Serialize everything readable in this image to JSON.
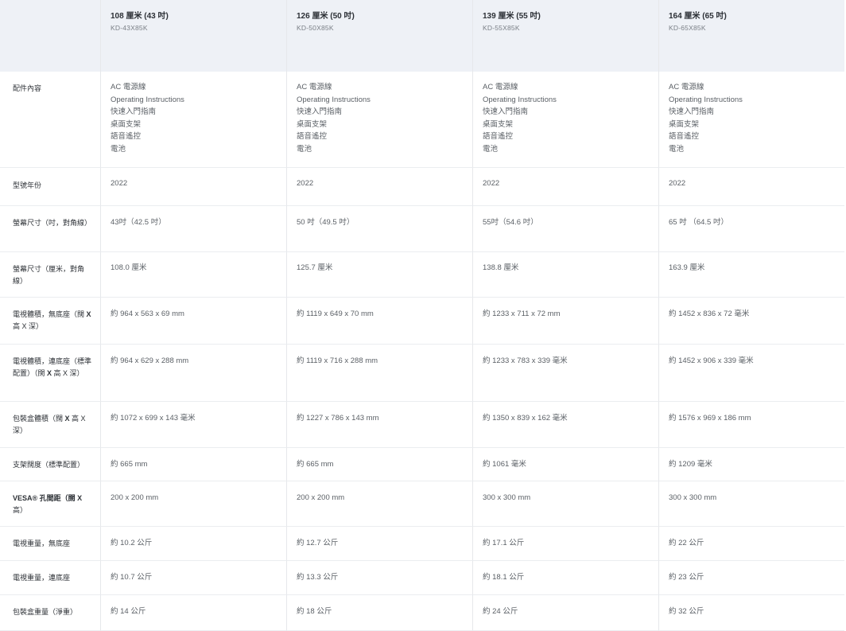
{
  "columns": [
    {
      "size": "108 厘米 (43 吋)",
      "model": "KD-43X85K"
    },
    {
      "size": "126 厘米 (50 吋)",
      "model": "KD-50X85K"
    },
    {
      "size": "139 厘米 (55 吋)",
      "model": "KD-55X85K"
    },
    {
      "size": "164 厘米 (65 吋)",
      "model": "KD-65X85K"
    }
  ],
  "accessories": {
    "label": "配件內容",
    "items": [
      "AC 電源線",
      "Operating Instructions",
      "快速入門指南",
      "桌面支架",
      "語音遙控",
      "電池"
    ]
  },
  "rows": [
    {
      "label": "型號年份",
      "values": [
        "2022",
        "2022",
        "2022",
        "2022"
      ]
    },
    {
      "label": "螢幕尺寸（吋，對角線）",
      "values": [
        "43吋（42.5 吋）",
        "50 吋（49.5 吋）",
        "55吋（54.6 吋）",
        "65 吋 （64.5 吋）"
      ]
    },
    {
      "label": "螢幕尺寸（厘米，對角線）",
      "values": [
        "108.0 厘米",
        "125.7 厘米",
        "138.8 厘米",
        "163.9 厘米"
      ]
    },
    {
      "label_pre": "電視體積，無底座（闊 ",
      "label_post": "高 X 深）",
      "values": [
        "約 964 x 563 x 69 mm",
        "約 1119 x 649 x 70 mm",
        "約 1233 x 711 x 72 mm",
        "約 1452 x 836 x 72 毫米"
      ]
    },
    {
      "label_pre": "電視體積，連底座（標準配置）（闊 ",
      "label_post": "高 X 深）",
      "values": [
        "約 964 x 629 x 288 mm",
        "約 1119 x 716 x 288 mm",
        "約 1233 x 783 x 339 毫米",
        "約 1452 x 906 x 339 毫米"
      ]
    },
    {
      "label_pre": "包裝盒體積（闊 ",
      "label_post": "高 X 深）",
      "values": [
        "約 1072 x 699 x 143 毫米",
        "約 1227 x 786 x 143 mm",
        "約 1350 x 839 x 162 毫米",
        "約 1576 x 969 x 186 mm"
      ]
    },
    {
      "label": "支架闊度（標準配置）",
      "values": [
        "約 665 mm",
        "約 665 mm",
        "約 1061 毫米",
        "約 1209 毫米"
      ]
    },
    {
      "label_pre": "VESA® 孔間距（闊 ",
      "label_post": "高）",
      "values": [
        "200 x 200 mm",
        "200 x 200 mm",
        "300 x 300 mm",
        "300 x 300 mm"
      ]
    },
    {
      "label": "電視重量，無底座",
      "values": [
        "約 10.2 公斤",
        "約 12.7 公斤",
        "約 17.1 公斤",
        "約 22 公斤"
      ]
    },
    {
      "label": "電視重量，連底座",
      "values": [
        "約 10.7 公斤",
        "約 13.3 公斤",
        "約 18.1 公斤",
        "約 23 公斤"
      ]
    },
    {
      "label": "包裝盒重量（淨重）",
      "values": [
        "約 14 公斤",
        "約 18 公斤",
        "約 24 公斤",
        "約 32 公斤"
      ]
    }
  ]
}
